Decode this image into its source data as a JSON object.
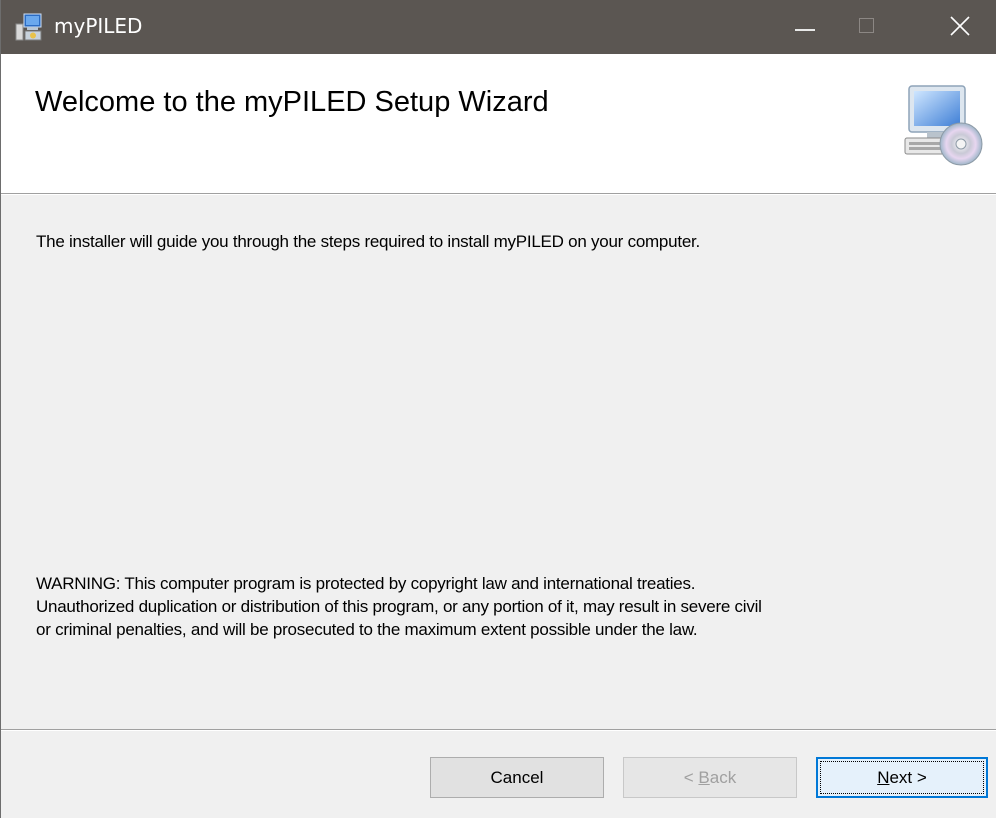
{
  "window": {
    "title": "myPILED",
    "title_bar_color": "#5b5652"
  },
  "icons": {
    "app": "installer-icon",
    "minimize": "minimize-icon",
    "maximize": "maximize-icon",
    "close": "close-icon",
    "banner": "computer-cd-icon"
  },
  "banner": {
    "title": "Welcome to the myPILED Setup Wizard"
  },
  "body": {
    "intro": "The installer will guide you through the steps required to install myPILED on your computer.",
    "warning_line1": "WARNING: This computer program is protected by copyright law and international treaties.",
    "warning_line2": "Unauthorized duplication or distribution of this program, or any portion of it, may result in severe civil",
    "warning_line3": "or criminal penalties, and will be prosecuted to the maximum extent possible under the law."
  },
  "buttons": {
    "cancel": "Cancel",
    "back_prefix": "< ",
    "back_mnemonic": "B",
    "back_rest": "ack",
    "next_mnemonic": "N",
    "next_rest": "ext >",
    "back_enabled": false,
    "accent": "#0078d7"
  }
}
